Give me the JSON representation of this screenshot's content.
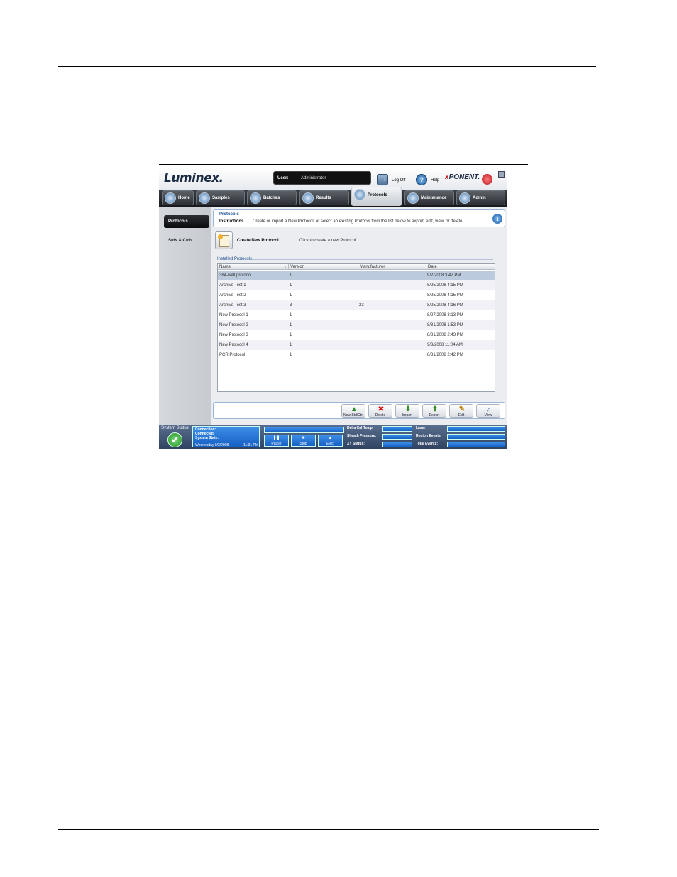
{
  "app": {
    "logo": "Luminex.",
    "user_label": "User:",
    "user_value": "Administrator",
    "logoff_label": "Log Off",
    "help_label": "Help",
    "help_glyph": "?",
    "xponent_x": "x",
    "xponent_rest": "PONENT."
  },
  "nav": {
    "tabs": [
      {
        "label": "Home"
      },
      {
        "label": "Samples"
      },
      {
        "label": "Batches"
      },
      {
        "label": "Results"
      },
      {
        "label": "Protocols"
      },
      {
        "label": "Maintenance"
      },
      {
        "label": "Admin"
      }
    ],
    "active": "Protocols"
  },
  "sidebar": {
    "items": [
      {
        "label": "Protocols"
      },
      {
        "label": "Stds & Ctrls"
      }
    ]
  },
  "instructions": {
    "title": "Protocols",
    "label": "Instructions",
    "text": "Create or import a New Protocol, or select an existing Protocol from the list below to export, edit, view, or delete.",
    "info_glyph": "i"
  },
  "create": {
    "label": "Create New Protocol",
    "hint": "Click to create a new Protocol."
  },
  "installed": {
    "label": "Installed Protocols",
    "columns": [
      "Name",
      "Version",
      "Manufacturer",
      "Date"
    ],
    "sort_indicator": "↓",
    "rows": [
      [
        "384-well protocol",
        "1",
        "",
        "9/2/2008 3:47 PM"
      ],
      [
        "Archive Test 1",
        "1",
        "",
        "8/25/2008 4:15 PM"
      ],
      [
        "Archive Test 2",
        "1",
        "",
        "8/25/2008 4:15 PM"
      ],
      [
        "Archive Test 3",
        "3",
        "23",
        "8/25/2008 4:16 PM"
      ],
      [
        "New Protocol 1",
        "1",
        "",
        "8/27/2008 3:13 PM"
      ],
      [
        "New Protocol 2",
        "1",
        "",
        "8/31/2008 1:53 PM"
      ],
      [
        "New Protocol 3",
        "1",
        "",
        "8/31/2008 2:43 PM"
      ],
      [
        "New Protocol 4",
        "1",
        "",
        "9/3/2008 11:04 AM"
      ],
      [
        "PCR Protocol",
        "1",
        "",
        "8/31/2008 2:42 PM"
      ]
    ],
    "selected_row": 0
  },
  "toolbar": {
    "buttons": [
      {
        "label": "New Std/Ctrl",
        "glyph": "▲",
        "color": "#2a8a2a"
      },
      {
        "label": "Delete",
        "glyph": "✖",
        "color": "#d11a1a"
      },
      {
        "label": "Import",
        "glyph": "⬇",
        "color": "#3a8d2a"
      },
      {
        "label": "Export",
        "glyph": "⬆",
        "color": "#3a8d2a"
      },
      {
        "label": "Edit",
        "glyph": "✎",
        "color": "#b8860b"
      },
      {
        "label": "View",
        "glyph": "⌕",
        "color": "#35609b"
      }
    ]
  },
  "status": {
    "label": "System Status",
    "ok_glyph": "✔",
    "connection_label": "Connection:",
    "connection_value": "Connected",
    "system_state_label": "System State:",
    "date": "Wednesday 9/3/2008",
    "time": "11:31 PM",
    "controls": [
      {
        "label": "Pause",
        "glyph": "❚❚"
      },
      {
        "label": "Stop",
        "glyph": "■"
      },
      {
        "label": "Eject",
        "glyph": "▲"
      }
    ],
    "stats": [
      {
        "label": "Delta Cal Temp:"
      },
      {
        "label": "Sheath Pressure:"
      },
      {
        "label": "XY Status:"
      },
      {
        "label": "Laser:"
      },
      {
        "label": "Region Events:"
      },
      {
        "label": "Total Events:"
      }
    ]
  }
}
